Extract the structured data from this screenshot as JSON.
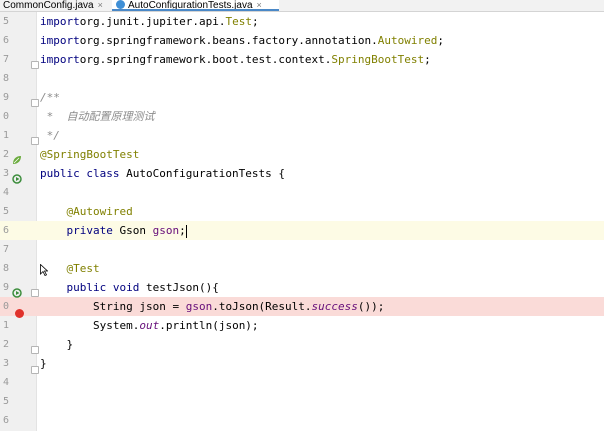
{
  "tabs": [
    {
      "label": "CommonConfig.java",
      "close": "×",
      "active": false
    },
    {
      "label": "AutoConfigurationTests.java",
      "close": "×",
      "active": true
    }
  ],
  "lines": [
    {
      "num": "5",
      "tokens": [
        [
          "kw",
          "import"
        ],
        [
          "",
          "org.junit.jupiter.api."
        ],
        [
          "ann",
          "Test"
        ],
        [
          "",
          ";"
        ]
      ]
    },
    {
      "num": "6",
      "tokens": [
        [
          "kw",
          "import"
        ],
        [
          "",
          "org.springframework.beans.factory.annotation."
        ],
        [
          "ann",
          "Autowired"
        ],
        [
          "",
          ";"
        ]
      ]
    },
    {
      "num": "7",
      "tokens": [
        [
          "kw",
          "import"
        ],
        [
          "",
          "org.springframework.boot.test.context."
        ],
        [
          "ann",
          "SpringBootTest"
        ],
        [
          "",
          ";"
        ]
      ]
    },
    {
      "num": "8",
      "tokens": []
    },
    {
      "num": "9",
      "tokens": [
        [
          "cmt",
          "/**"
        ]
      ]
    },
    {
      "num": "0",
      "tokens": [
        [
          "cmt",
          " *  自动配置原理测试"
        ]
      ]
    },
    {
      "num": "1",
      "tokens": [
        [
          "cmt",
          " */"
        ]
      ]
    },
    {
      "num": "2",
      "tokens": [
        [
          "ann",
          "@SpringBootTest"
        ]
      ]
    },
    {
      "num": "3",
      "tokens": [
        [
          "kw",
          "public class "
        ],
        [
          "",
          "AutoConfigurationTests {"
        ]
      ]
    },
    {
      "num": "4",
      "tokens": []
    },
    {
      "num": "5",
      "tokens": [
        [
          "",
          "    "
        ],
        [
          "ann",
          "@Autowired"
        ]
      ]
    },
    {
      "num": "6",
      "tokens": [
        [
          "",
          "    "
        ],
        [
          "kw",
          "private "
        ],
        [
          "",
          "Gson "
        ],
        [
          "fld",
          "gson"
        ],
        [
          "",
          ";"
        ]
      ]
    },
    {
      "num": "7",
      "tokens": []
    },
    {
      "num": "8",
      "tokens": [
        [
          "",
          "    "
        ],
        [
          "ann",
          "@Test"
        ]
      ]
    },
    {
      "num": "9",
      "tokens": [
        [
          "",
          "    "
        ],
        [
          "kw",
          "public void "
        ],
        [
          "",
          "testJson(){"
        ]
      ]
    },
    {
      "num": "0",
      "tokens": [
        [
          "",
          "        String json = "
        ],
        [
          "fld",
          "gson"
        ],
        [
          "",
          ".toJson(Result."
        ],
        [
          "it",
          "success"
        ],
        [
          "",
          "());"
        ]
      ]
    },
    {
      "num": "1",
      "tokens": [
        [
          "",
          "        System."
        ],
        [
          "it",
          "out"
        ],
        [
          "",
          ".println(json);"
        ]
      ]
    },
    {
      "num": "2",
      "tokens": [
        [
          "",
          "    }"
        ]
      ]
    },
    {
      "num": "3",
      "tokens": [
        [
          "",
          "}"
        ]
      ]
    },
    {
      "num": "4",
      "tokens": []
    },
    {
      "num": "5",
      "tokens": []
    },
    {
      "num": "6",
      "tokens": []
    }
  ],
  "colors": {
    "keyword": "#00007f",
    "annotation": "#808000",
    "comment": "#8c8c8c",
    "breakpoint": "#e0312b",
    "caret_line": "#fdfbe5",
    "breakpoint_line": "#fadbd8"
  },
  "gutter_icons": {
    "spring_bean": "leaf-icon",
    "run_test": "run-test-icon",
    "breakpoint": "breakpoint-icon",
    "fold": "fold-marker-icon"
  }
}
